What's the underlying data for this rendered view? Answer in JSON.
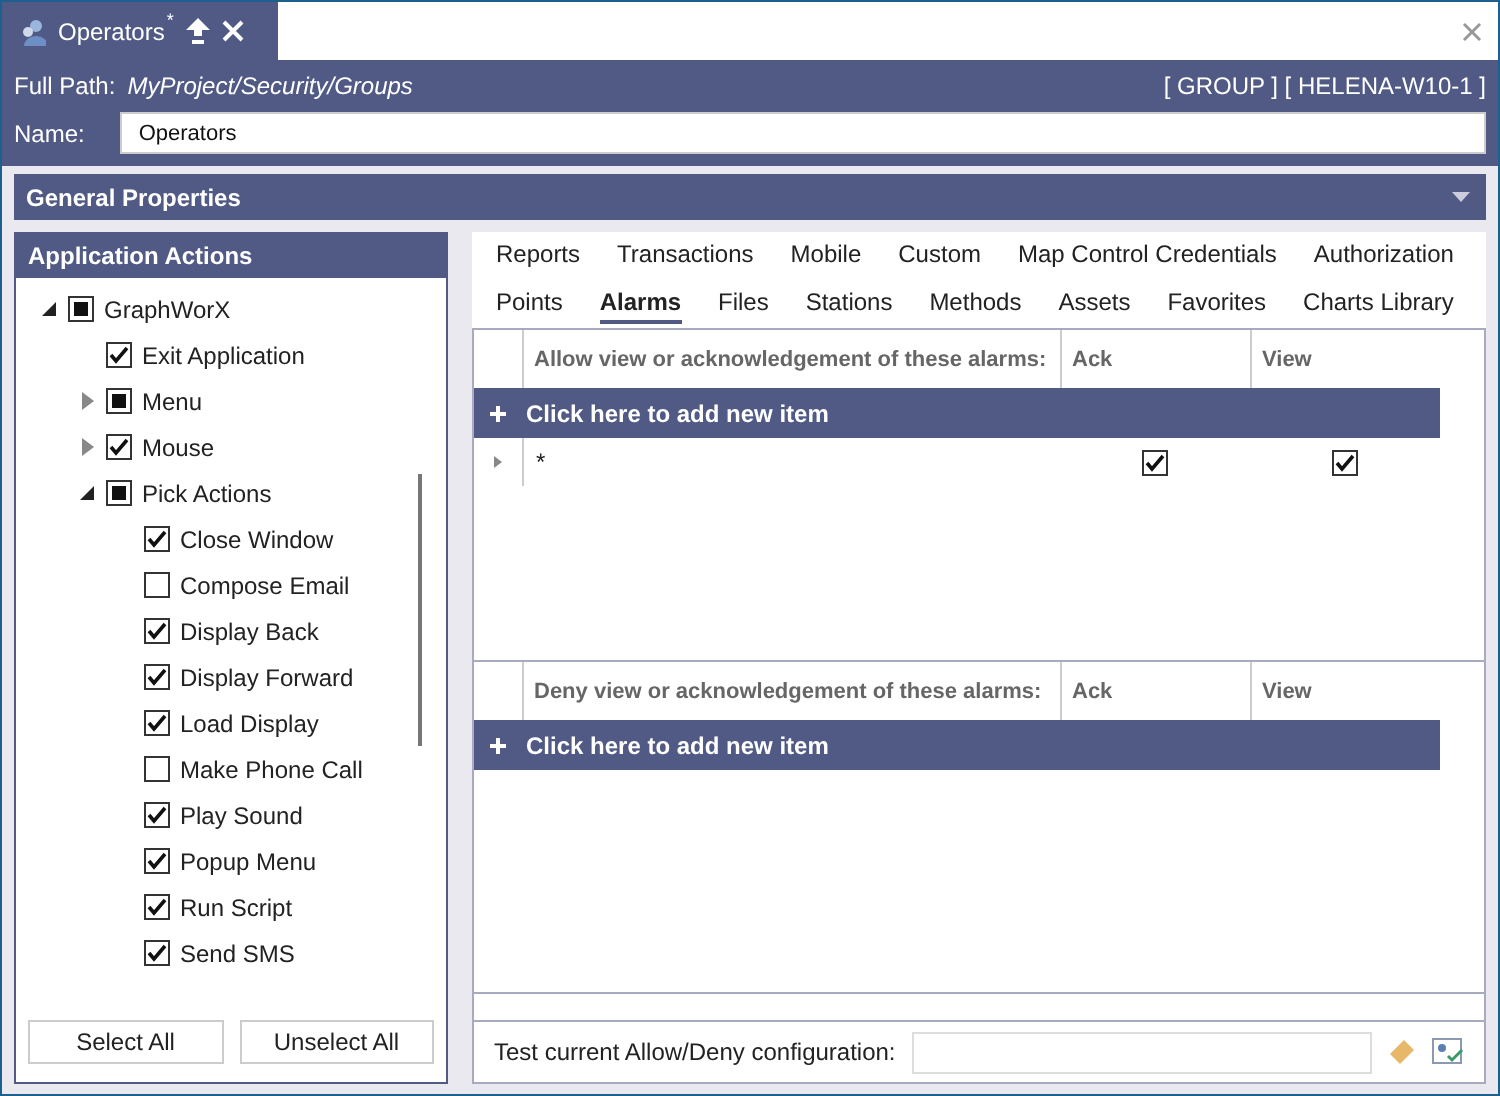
{
  "doc_tab": {
    "title": "Operators",
    "modified": "*"
  },
  "header": {
    "full_path_label": "Full Path:",
    "full_path": "MyProject/Security/Groups",
    "info": "[ GROUP ] [ HELENA-W10-1 ]",
    "name_label": "Name:",
    "name_value": "Operators"
  },
  "general_properties": {
    "title": "General Properties",
    "expanded": false
  },
  "application_actions": {
    "title": "Application Actions",
    "tree": [
      {
        "label": "GraphWorX",
        "checked": false,
        "indeterminate": true,
        "expanded": true,
        "children": [
          {
            "label": "Exit Application",
            "checked": true,
            "indeterminate": false
          },
          {
            "label": "Menu",
            "checked": false,
            "indeterminate": true,
            "expanded": false
          },
          {
            "label": "Mouse",
            "checked": true,
            "indeterminate": false,
            "expanded": false
          },
          {
            "label": "Pick Actions",
            "checked": false,
            "indeterminate": true,
            "expanded": true,
            "children": [
              {
                "label": "Close Window",
                "checked": true,
                "indeterminate": false
              },
              {
                "label": "Compose Email",
                "checked": false,
                "indeterminate": false
              },
              {
                "label": "Display Back",
                "checked": true,
                "indeterminate": false
              },
              {
                "label": "Display Forward",
                "checked": true,
                "indeterminate": false
              },
              {
                "label": "Load Display",
                "checked": true,
                "indeterminate": false
              },
              {
                "label": "Make Phone Call",
                "checked": false,
                "indeterminate": false
              },
              {
                "label": "Play Sound",
                "checked": true,
                "indeterminate": false
              },
              {
                "label": "Popup Menu",
                "checked": true,
                "indeterminate": false
              },
              {
                "label": "Run Script",
                "checked": true,
                "indeterminate": false
              },
              {
                "label": "Send SMS",
                "checked": true,
                "indeterminate": false
              }
            ]
          }
        ]
      }
    ],
    "buttons": [
      "Select All",
      "Unselect All"
    ]
  },
  "tabs": [
    [
      {
        "label": "Reports",
        "selected": false
      },
      {
        "label": "Transactions",
        "selected": false
      },
      {
        "label": "Mobile",
        "selected": false
      },
      {
        "label": "Custom",
        "selected": false
      },
      {
        "label": "Map Control Credentials",
        "selected": false
      },
      {
        "label": "Authorization",
        "selected": false
      }
    ],
    [
      {
        "label": "Points",
        "selected": false
      },
      {
        "label": "Alarms",
        "selected": true
      },
      {
        "label": "Files",
        "selected": false
      },
      {
        "label": "Stations",
        "selected": false
      },
      {
        "label": "Methods",
        "selected": false
      },
      {
        "label": "Assets",
        "selected": false
      },
      {
        "label": "Favorites",
        "selected": false
      },
      {
        "label": "Charts Library",
        "selected": false
      }
    ]
  ],
  "grids": [
    {
      "columns": [
        "Allow view or acknowledgement of these alarms:",
        "Ack",
        "View"
      ],
      "add_row": "Click here to add new item",
      "rows": [
        {
          "pattern": "*",
          "ack": true,
          "view": true
        }
      ]
    },
    {
      "columns": [
        "Deny view or acknowledgement of these alarms:",
        "Ack",
        "View"
      ],
      "add_row": "Click here to add new item"
    }
  ],
  "test_bar": {
    "label": "Test current Allow/Deny configuration:"
  }
}
